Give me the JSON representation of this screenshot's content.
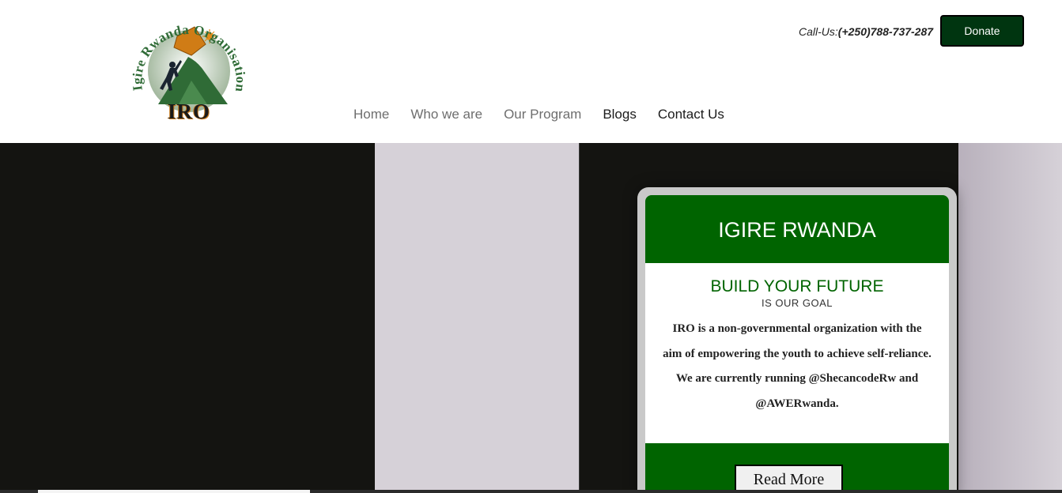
{
  "brand": {
    "logo_ring_text": "Igire Rwanda Organisation",
    "logo_caption": "IRO"
  },
  "header": {
    "call_label": "Call-Us:",
    "call_number": "(+250)788-737-287",
    "donate_label": "Donate",
    "nav": [
      {
        "label": "Home",
        "tone": "muted"
      },
      {
        "label": "Who we are",
        "tone": "muted"
      },
      {
        "label": "Our Program",
        "tone": "muted"
      },
      {
        "label": "Blogs",
        "tone": "dark"
      },
      {
        "label": "Contact Us",
        "tone": "dark"
      }
    ]
  },
  "hero_card": {
    "title": "IGIRE RWANDA",
    "tagline": "BUILD YOUR FUTURE",
    "subtagline": "IS OUR GOAL",
    "description": "IRO is a non-governmental organization with the aim of empowering the youth to achieve self-reliance. We are currently running @ShecancodeRw and @AWERwanda.",
    "button_label": "Read More"
  },
  "colors": {
    "brand_green": "#006400",
    "donate_bg": "#003510",
    "dark_panel": "#141411",
    "light_panel": "#d6d1d8"
  }
}
